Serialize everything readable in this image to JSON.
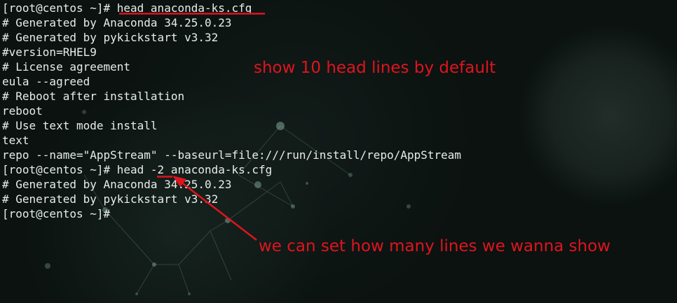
{
  "terminal": {
    "lines": [
      "[root@centos ~]# head anaconda-ks.cfg",
      "# Generated by Anaconda 34.25.0.23",
      "# Generated by pykickstart v3.32",
      "#version=RHEL9",
      "# License agreement",
      "eula --agreed",
      "# Reboot after installation",
      "reboot",
      "# Use text mode install",
      "text",
      "repo --name=\"AppStream\" --baseurl=file:///run/install/repo/AppStream",
      "[root@centos ~]# head -2 anaconda-ks.cfg",
      "# Generated by Anaconda 34.25.0.23",
      "# Generated by pykickstart v3.32",
      "[root@centos ~]#"
    ]
  },
  "annotations": {
    "top_note": "show 10 head lines by default",
    "bottom_note": "we can set how many lines we wanna show",
    "color": "#e0141e"
  },
  "colors": {
    "background": "#0b1210",
    "text": "#e8ecea"
  }
}
